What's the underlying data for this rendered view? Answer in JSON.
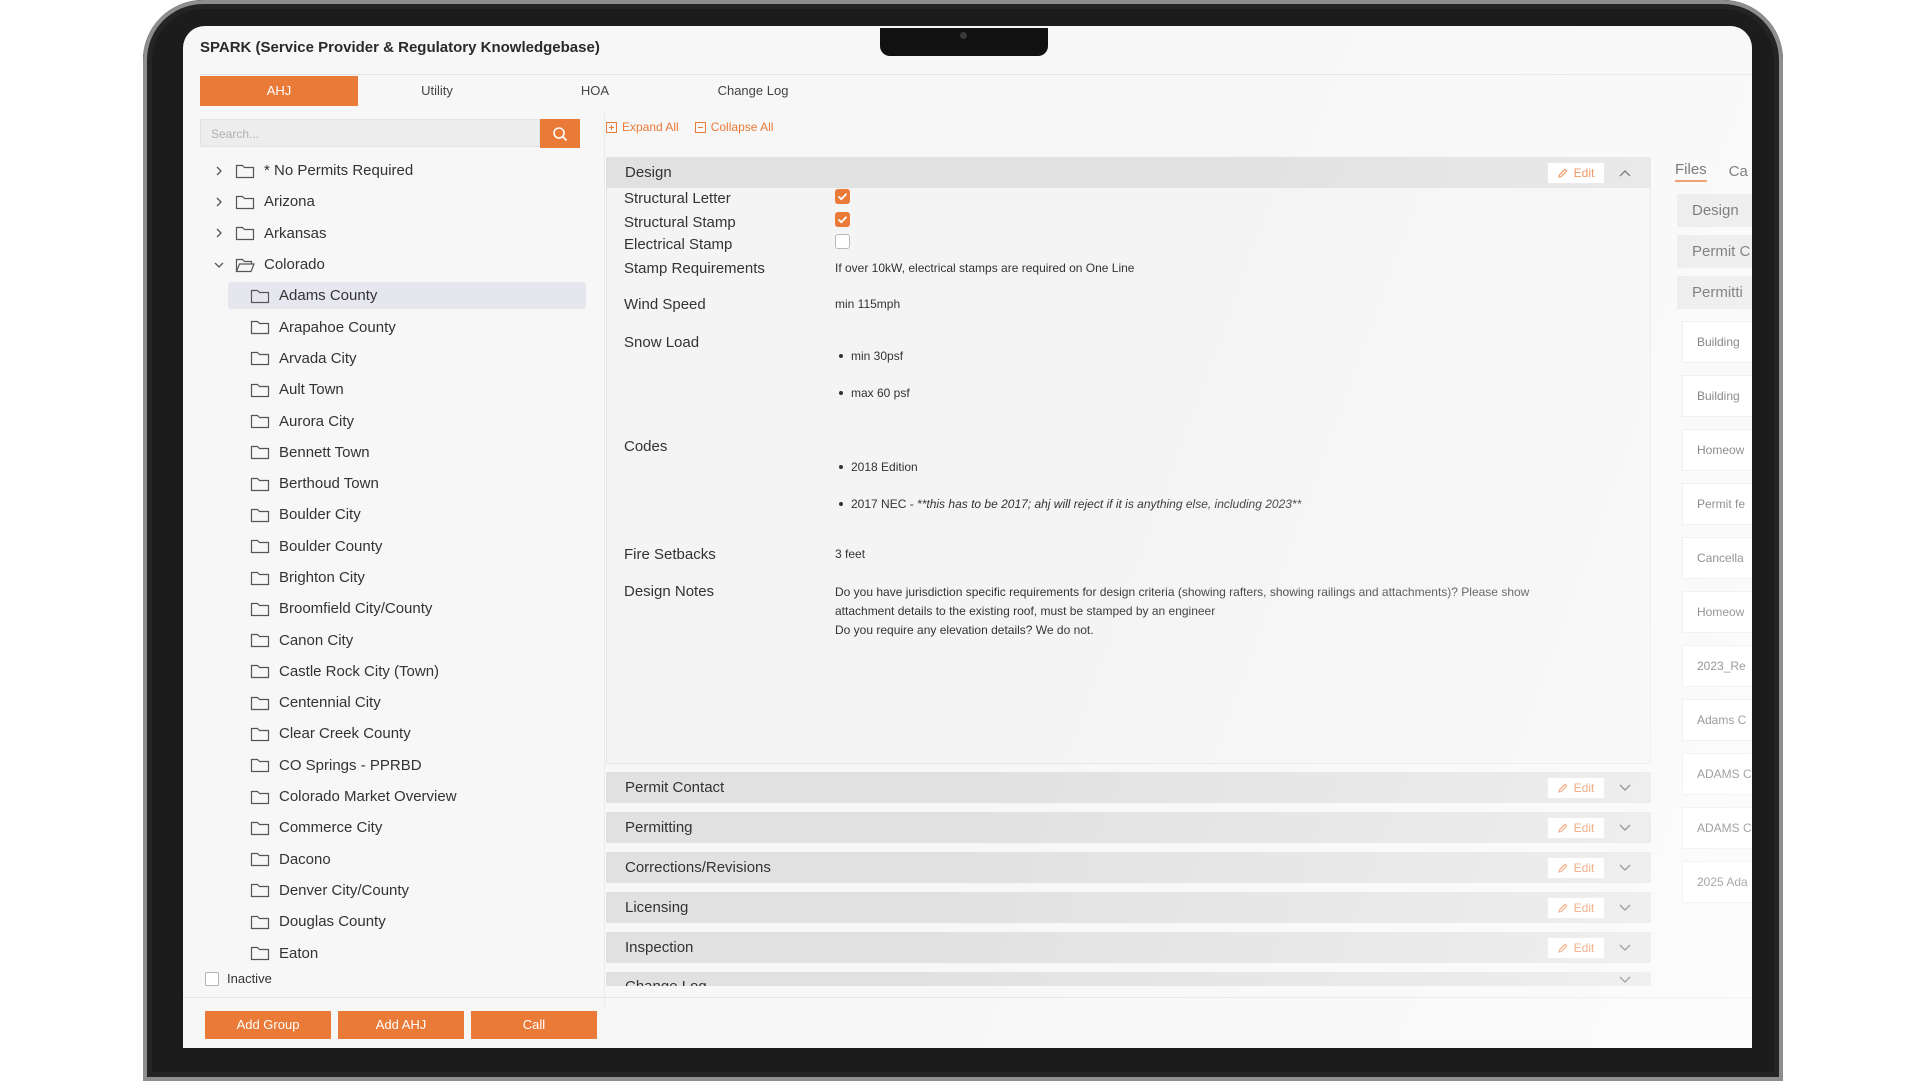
{
  "app": {
    "title": "SPARK (Service Provider & Regulatory Knowledgebase)"
  },
  "tabs": [
    {
      "label": "AHJ",
      "active": true
    },
    {
      "label": "Utility"
    },
    {
      "label": "HOA"
    },
    {
      "label": "Change Log"
    }
  ],
  "search": {
    "placeholder": "Search..."
  },
  "tree": {
    "items": [
      {
        "label": "* No Permits Required",
        "expanded": false
      },
      {
        "label": "Arizona",
        "expanded": false
      },
      {
        "label": "Arkansas",
        "expanded": false
      },
      {
        "label": "Colorado",
        "expanded": true
      },
      {
        "label": "Adams County",
        "selected": true
      },
      {
        "label": "Arapahoe County"
      },
      {
        "label": "Arvada City"
      },
      {
        "label": "Ault Town"
      },
      {
        "label": "Aurora City"
      },
      {
        "label": "Bennett Town"
      },
      {
        "label": "Berthoud Town"
      },
      {
        "label": "Boulder City"
      },
      {
        "label": "Boulder County"
      },
      {
        "label": "Brighton City"
      },
      {
        "label": "Broomfield City/County"
      },
      {
        "label": "Canon City"
      },
      {
        "label": "Castle Rock City (Town)"
      },
      {
        "label": "Centennial City"
      },
      {
        "label": "Clear Creek County"
      },
      {
        "label": "CO Springs - PPRBD"
      },
      {
        "label": "Colorado Market Overview"
      },
      {
        "label": "Commerce City"
      },
      {
        "label": "Dacono"
      },
      {
        "label": "Denver City/County"
      },
      {
        "label": "Douglas County"
      },
      {
        "label": "Eaton"
      }
    ]
  },
  "inactive_label": "Inactive",
  "buttons": {
    "add_group": "Add Group",
    "add_ahj": "Add AHJ",
    "call": "Call"
  },
  "toolbar": {
    "expand_all": "Expand All",
    "collapse_all": "Collapse All"
  },
  "edit_label": "Edit",
  "design": {
    "title": "Design",
    "structural_letter": {
      "label": "Structural Letter",
      "checked": true
    },
    "structural_stamp": {
      "label": "Structural Stamp",
      "checked": true
    },
    "electrical_stamp": {
      "label": "Electrical Stamp",
      "checked": false
    },
    "stamp_requirements": {
      "label": "Stamp Requirements",
      "value": "If over 10kW, electrical stamps are required on One Line"
    },
    "wind_speed": {
      "label": "Wind Speed",
      "value": "min 115mph"
    },
    "snow_load": {
      "label": "Snow Load",
      "values": [
        "min 30psf",
        "max 60 psf"
      ]
    },
    "codes": {
      "label": "Codes",
      "item1": "2018 Edition",
      "item2_bold": "2017 NEC - ",
      "item2_italic": "**this has to be 2017; ahj will reject if it is anything else, including 2023**"
    },
    "fire_setbacks": {
      "label": "Fire Setbacks",
      "value": "3 feet"
    },
    "design_notes": {
      "label": "Design Notes",
      "line1": "Do you have jurisdiction specific requirements for design criteria (showing rafters, showing railings and attachments)? Please show",
      "line2": "attachment details to the existing roof, must be stamped by an engineer",
      "line3": "Do you require any elevation details? We do not."
    }
  },
  "sections": [
    {
      "title": "Permit Contact"
    },
    {
      "title": "Permitting"
    },
    {
      "title": "Corrections/Revisions"
    },
    {
      "title": "Licensing"
    },
    {
      "title": "Inspection"
    },
    {
      "title": "Change Log"
    }
  ],
  "files_panel": {
    "tabs": [
      "Files",
      "Ca"
    ],
    "groups": [
      "Design",
      "Permit C",
      "Permitti"
    ],
    "files": [
      "Building",
      "Building",
      "Homeow",
      "Permit fe",
      "Cancella",
      "Homeow",
      "2023_Re",
      "Adams C",
      "ADAMS C",
      "ADAMS C",
      "2025 Ada"
    ]
  },
  "colors": {
    "accent": "#ea7a37",
    "section_bg": "#e1e1e1"
  }
}
